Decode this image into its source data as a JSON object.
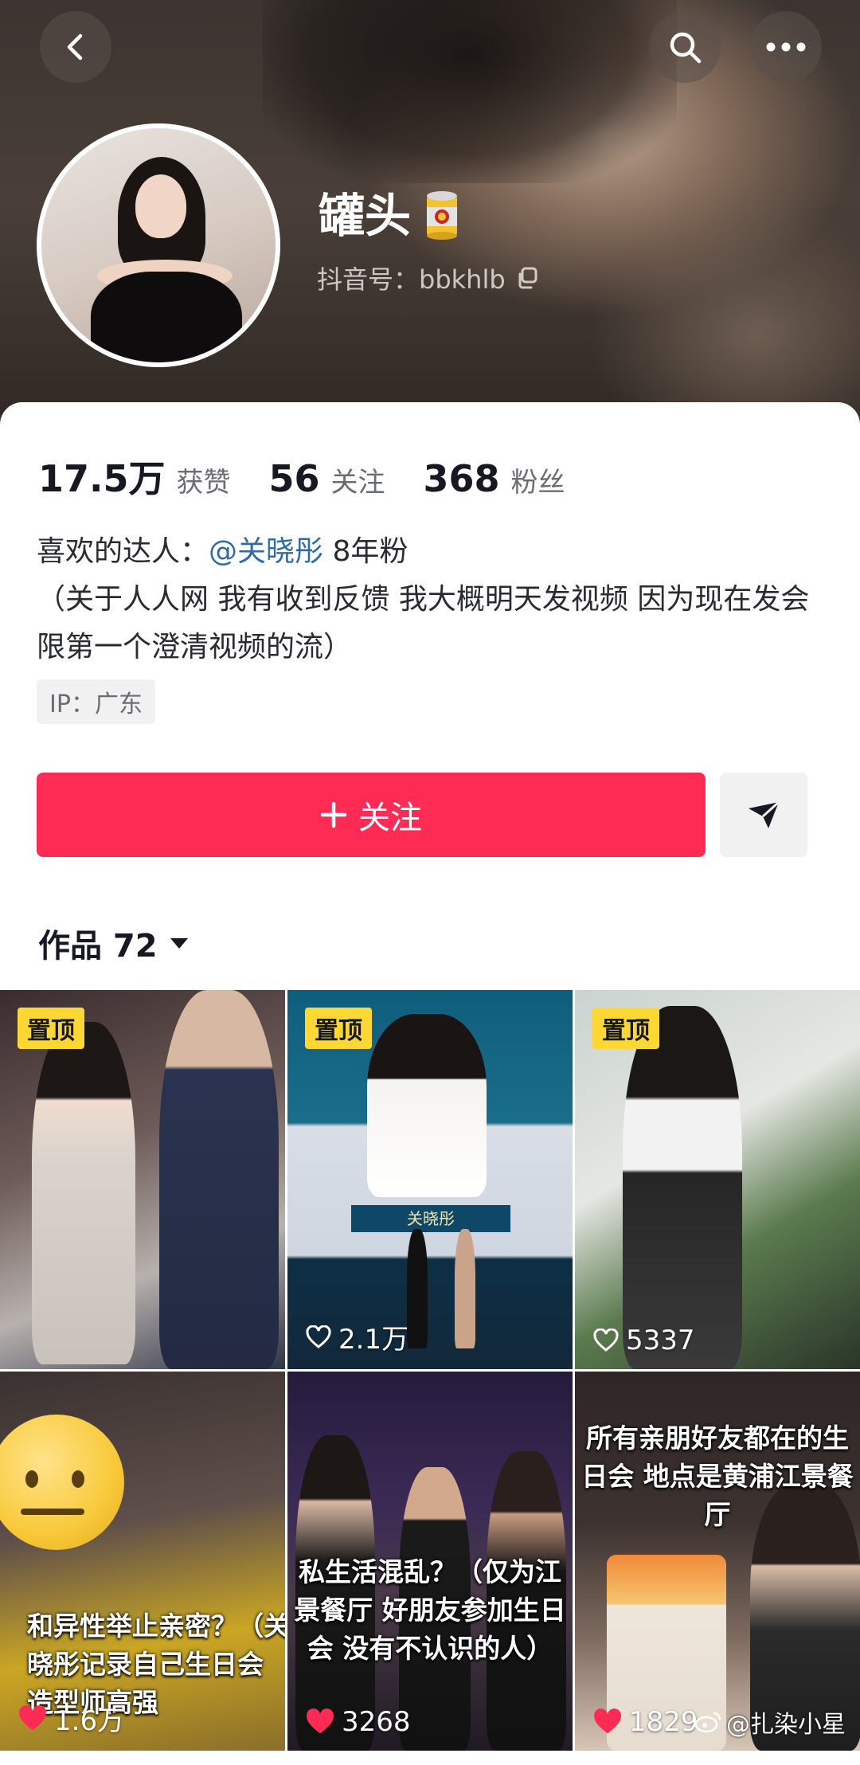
{
  "header": {
    "nickname": "罐头",
    "nickname_emoji": "canned-food-icon",
    "douyin_id": "抖音号：bbkhlb"
  },
  "stats": {
    "likes_value": "17.5万",
    "likes_label": "获赞",
    "following_value": "56",
    "following_label": "关注",
    "followers_value": "368",
    "followers_label": "粉丝"
  },
  "bio": {
    "line1_prefix": "喜欢的达人：",
    "mention": "@关晓彤",
    "line1_suffix": " 8年粉",
    "line2": "（关于人人网 我有收到反馈 我大概明天发视频 因为现在发会限第一个澄清视频的流）",
    "ip": "IP：广东"
  },
  "actions": {
    "follow_label": "关注"
  },
  "works_tab": {
    "label": "作品 72"
  },
  "videos": [
    {
      "pinned": "置顶",
      "likes": ""
    },
    {
      "pinned": "置顶",
      "likes": "2.1万",
      "caption_name": "关晓彤"
    },
    {
      "pinned": "置顶",
      "likes": "5337"
    },
    {
      "likes": "1.6万",
      "overlay": "和异性举止亲密？（关晓彤记录自己生日会 造型师高强"
    },
    {
      "likes": "3268",
      "overlay": "私生活混乱？（仅为江景餐厅 好朋友参加生日会 没有不认识的人）"
    },
    {
      "likes": "1829",
      "overlay": "所有亲朋好友都在的生日会 地点是黄浦江景餐厅"
    }
  ],
  "watermark": "@扎染小星",
  "colors": {
    "accent": "#fe2c55",
    "mention": "#2e6ba8",
    "pin_badge": "#fdd835"
  }
}
